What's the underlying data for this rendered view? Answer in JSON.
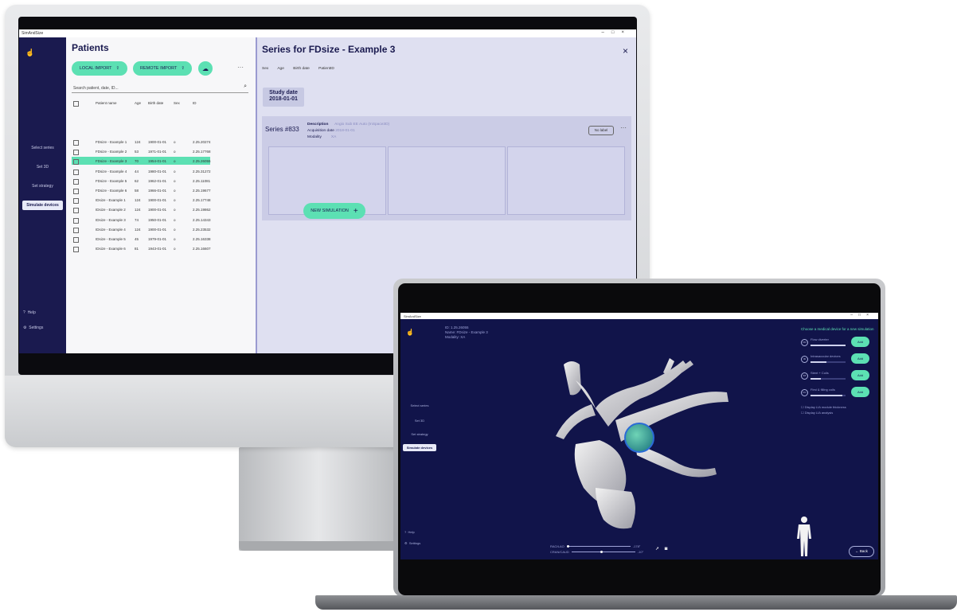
{
  "desktop": {
    "app_title": "SimAndSize",
    "window_controls": [
      "–",
      "□",
      "×"
    ],
    "nav": {
      "logo_icon": "hand-icon",
      "items": [
        "Select series",
        "Set 3D",
        "Set strategy",
        "Simulate devices"
      ],
      "active_item": "Simulate devices",
      "help": "Help",
      "settings": "Settings"
    },
    "patients": {
      "title": "Patients",
      "local_import": "LOCAL IMPORT",
      "remote_import": "REMOTE IMPORT",
      "more": "···",
      "search_placeholder": "Search patient, date, ID...",
      "columns": [
        "Patient name",
        "Age",
        "Birth date",
        "Sex",
        "ID"
      ],
      "rows": [
        {
          "name": "FDsize - Example 1",
          "age": "124",
          "birth": "1900-01-01",
          "sex": "o",
          "id": "2.25.20274"
        },
        {
          "name": "FDsize - Example 2",
          "age": "53",
          "birth": "1971-01-01",
          "sex": "o",
          "id": "2.25.17768"
        },
        {
          "name": "FDsize - Example 3",
          "age": "70",
          "birth": "1954-01-01",
          "sex": "o",
          "id": "2.25.26055"
        },
        {
          "name": "FDsize - Example 4",
          "age": "44",
          "birth": "1980-01-01",
          "sex": "o",
          "id": "2.25.31272"
        },
        {
          "name": "FDsize - Example 5",
          "age": "62",
          "birth": "1962-01-01",
          "sex": "o",
          "id": "2.25.11081"
        },
        {
          "name": "FDsize - Example 6",
          "age": "58",
          "birth": "1966-01-01",
          "sex": "o",
          "id": "2.25.19677"
        },
        {
          "name": "IDsize - Example 1",
          "age": "124",
          "birth": "1900-01-01",
          "sex": "o",
          "id": "2.25.17748"
        },
        {
          "name": "IDsize - Example 2",
          "age": "124",
          "birth": "1900-01-01",
          "sex": "o",
          "id": "2.25.19862"
        },
        {
          "name": "IDsize - Example 3",
          "age": "74",
          "birth": "1950-01-01",
          "sex": "o",
          "id": "2.25.14343"
        },
        {
          "name": "IDsize - Example 4",
          "age": "124",
          "birth": "1900-01-01",
          "sex": "o",
          "id": "2.25.23532"
        },
        {
          "name": "IDsize - Example 5",
          "age": "45",
          "birth": "1979-01-01",
          "sex": "o",
          "id": "2.25.16338"
        },
        {
          "name": "IDsize - Example 6",
          "age": "81",
          "birth": "1943-01-01",
          "sex": "o",
          "id": "2.25.16607"
        }
      ],
      "selected_row": "FDsize - Example 3"
    },
    "series_panel": {
      "title": "Series for FDsize - Example 3",
      "close": "×",
      "meta_labels": [
        "Sex",
        "Age",
        "Birth date",
        "PatientID"
      ],
      "study_label": "Study date",
      "study_date": "2018-01-01",
      "series_number": "Series #833",
      "description_label": "Description",
      "description_value": "Angio Sub EE Auto (InSpace3D)",
      "acq_label": "Acquisition date",
      "acq_value": "2018-01-01",
      "modality_label": "Modality",
      "modality_value": "XA",
      "no_label": "No label",
      "more": "···",
      "new_simulation": "NEW SIMULATION",
      "plus": "+"
    }
  },
  "laptop": {
    "app_title": "SimAndSize",
    "window_controls": [
      "–",
      "□",
      "×"
    ],
    "info": {
      "id_line": "ID: 1.25.26055",
      "name_line": "Name: FDsize - Example 3",
      "modality_line": "Modality: XA"
    },
    "nav": {
      "items": [
        "Select series",
        "Set 3D",
        "Set strategy",
        "Simulate devices"
      ],
      "active_item": "Simulate devices",
      "help": "Help",
      "settings": "Settings"
    },
    "right_panel": {
      "heading": "Choose a medical device for a new simulation",
      "devices": [
        {
          "icon": "FD",
          "name": "Flow diverter",
          "add": "Add",
          "level": 1.0
        },
        {
          "icon": "ID",
          "name": "Intrasaccular devices",
          "add": "Add",
          "level": 0.45
        },
        {
          "icon": "ST",
          "name": "Stent + Coils",
          "add": "Add",
          "level": 0.3
        },
        {
          "icon": "FC",
          "name": "First & filling coils",
          "add": "Add",
          "level": 0.9
        }
      ],
      "checkbox_1": "Display LIA module thickness",
      "checkbox_2": "Display LIA analysis"
    },
    "viewer": {
      "slider_1_label": "RAO/LAO",
      "slider_1_value": "-178°",
      "slider_1_level": 0.0,
      "slider_2_label": "CRAN/CAUD",
      "slider_2_value": "-10°",
      "slider_2_level": 0.45,
      "back": "Back",
      "tool_icons": [
        "pointer-icon",
        "camera-icon"
      ]
    }
  }
}
